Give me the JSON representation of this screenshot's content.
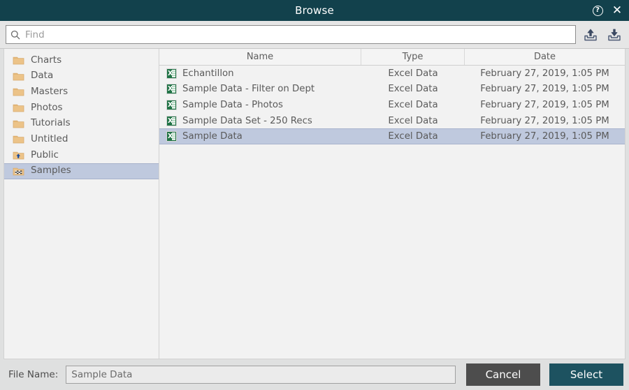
{
  "window": {
    "title": "Browse",
    "help_icon": "help-circle-icon",
    "close_icon": "close-icon"
  },
  "toolbar": {
    "search_placeholder": "Find",
    "search_value": "",
    "search_icon": "search-icon",
    "upload_icon": "upload-icon",
    "download_icon": "download-icon"
  },
  "sidebar": {
    "items": [
      {
        "label": "Charts",
        "icon": "folder-icon",
        "selected": false
      },
      {
        "label": "Data",
        "icon": "folder-icon",
        "selected": false
      },
      {
        "label": "Masters",
        "icon": "folder-icon",
        "selected": false
      },
      {
        "label": "Photos",
        "icon": "folder-icon",
        "selected": false
      },
      {
        "label": "Tutorials",
        "icon": "folder-icon",
        "selected": false
      },
      {
        "label": "Untitled",
        "icon": "folder-icon",
        "selected": false
      },
      {
        "label": "Public",
        "icon": "folder-shared-icon",
        "selected": false
      },
      {
        "label": "Samples",
        "icon": "folder-samples-icon",
        "selected": true
      }
    ]
  },
  "filelist": {
    "columns": [
      "Name",
      "Type",
      "Date"
    ],
    "rows": [
      {
        "name": "Echantillon",
        "type": "Excel Data",
        "date": "February 27, 2019, 1:05 PM",
        "icon": "excel-file-icon",
        "selected": false
      },
      {
        "name": "Sample Data - Filter on Dept",
        "type": "Excel Data",
        "date": "February 27, 2019, 1:05 PM",
        "icon": "excel-file-icon",
        "selected": false
      },
      {
        "name": "Sample Data - Photos",
        "type": "Excel Data",
        "date": "February 27, 2019, 1:05 PM",
        "icon": "excel-file-icon",
        "selected": false
      },
      {
        "name": "Sample Data Set - 250 Recs",
        "type": "Excel Data",
        "date": "February 27, 2019, 1:05 PM",
        "icon": "excel-file-icon",
        "selected": false
      },
      {
        "name": "Sample Data",
        "type": "Excel Data",
        "date": "February 27, 2019, 1:05 PM",
        "icon": "excel-file-icon",
        "selected": true
      }
    ]
  },
  "footer": {
    "file_name_label": "File Name:",
    "file_name_value": "Sample Data",
    "cancel_label": "Cancel",
    "select_label": "Select"
  },
  "colors": {
    "titlebar": "#12414c",
    "accent_button": "#1d5260",
    "cancel_button": "#4d4d4d",
    "selection": "#bfc9de",
    "panel": "#f2f2f2",
    "excel_green": "#217346",
    "folder_tan": "#ecc388"
  }
}
